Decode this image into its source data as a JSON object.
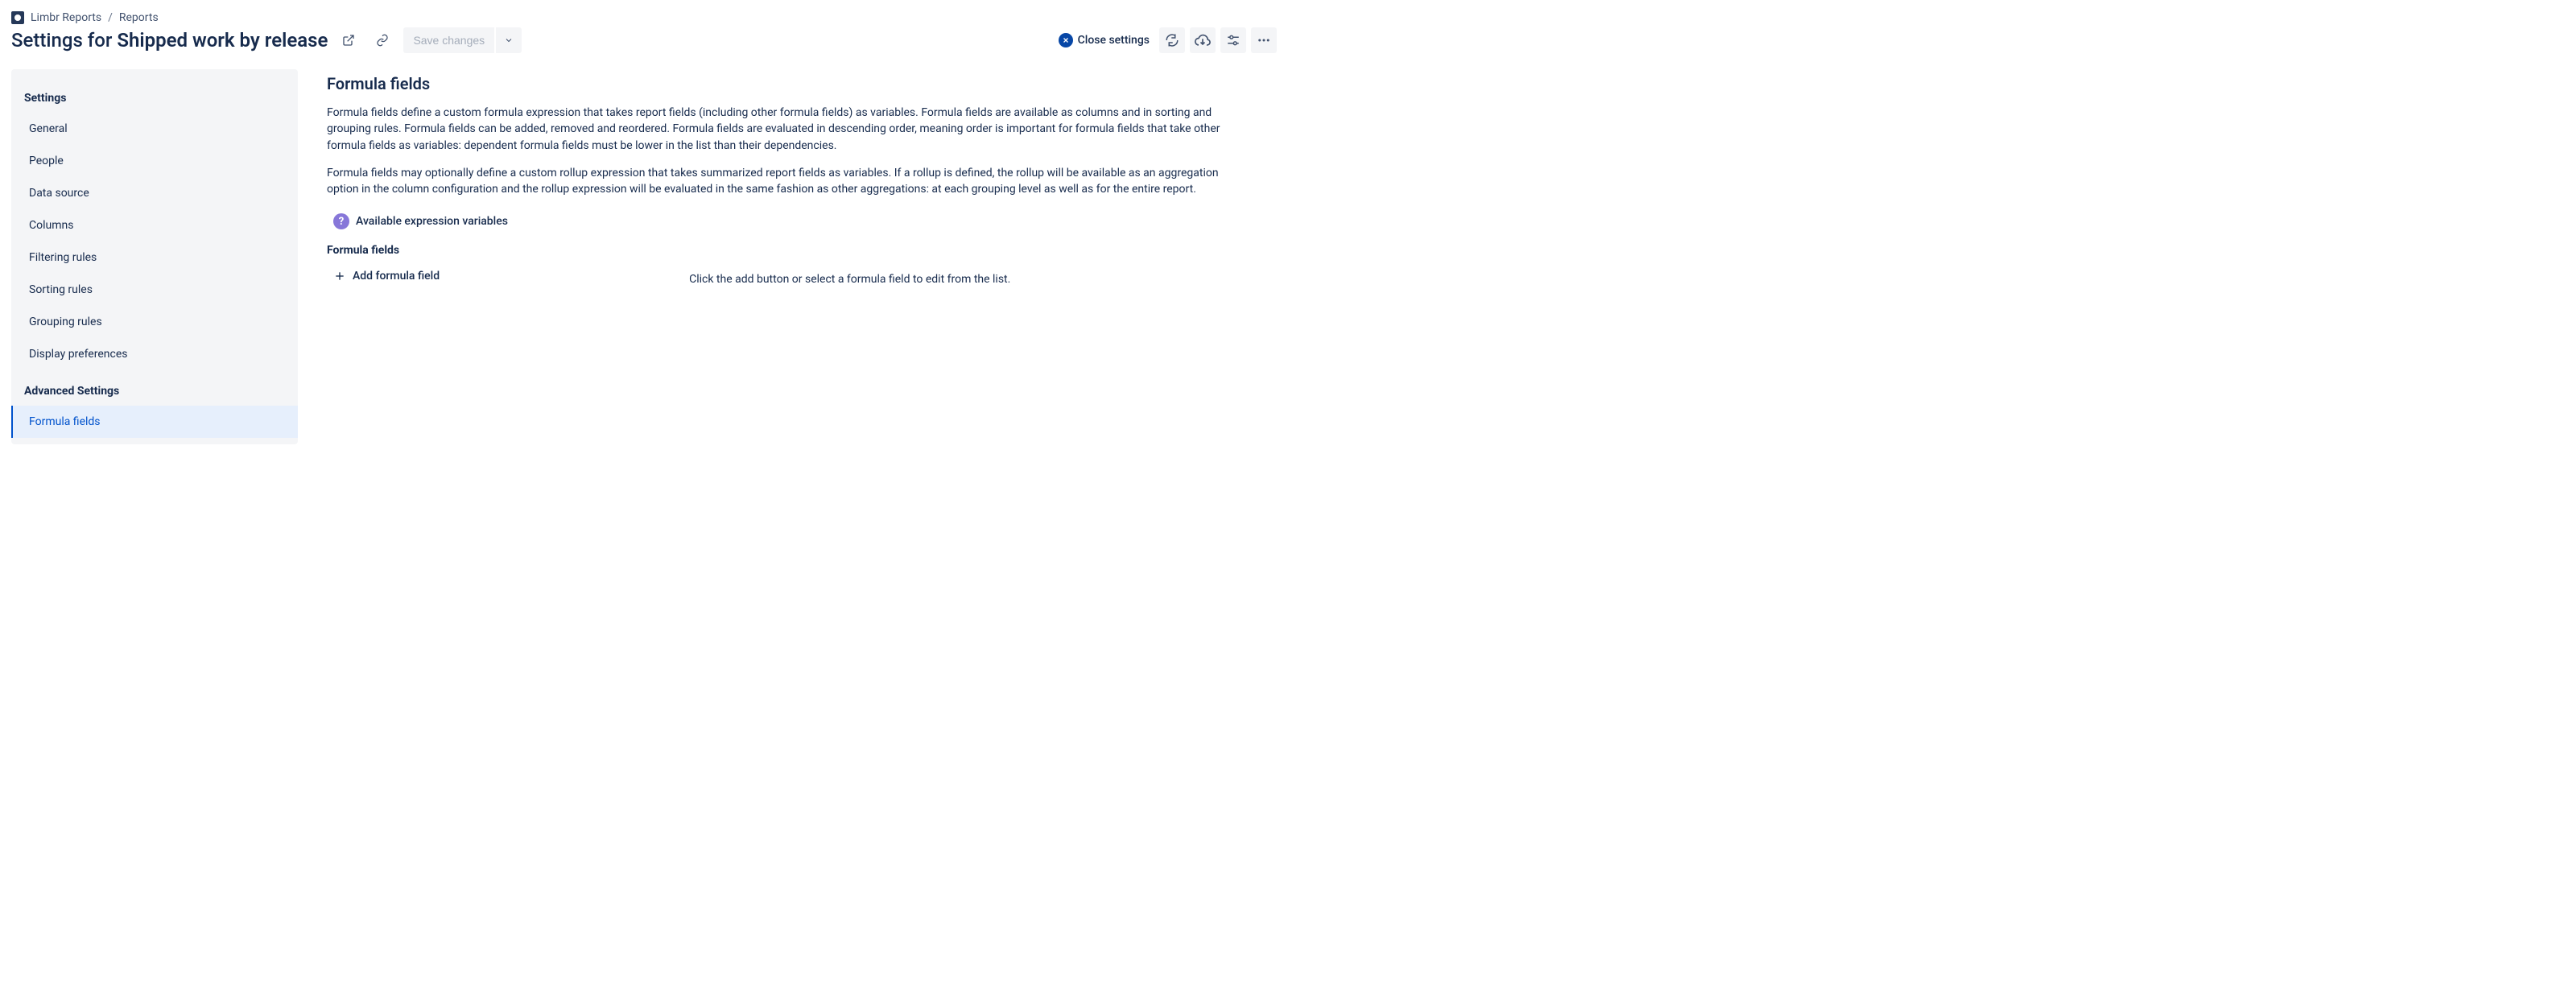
{
  "breadcrumb": {
    "app": "Limbr Reports",
    "section": "Reports"
  },
  "header": {
    "title_prefix": "Settings for ",
    "title_bold": "Shipped work by release",
    "save_label": "Save changes",
    "close_label": "Close settings"
  },
  "sidebar": {
    "heading1": "Settings",
    "items1": [
      {
        "label": "General"
      },
      {
        "label": "People"
      },
      {
        "label": "Data source"
      },
      {
        "label": "Columns"
      },
      {
        "label": "Filtering rules"
      },
      {
        "label": "Sorting rules"
      },
      {
        "label": "Grouping rules"
      },
      {
        "label": "Display preferences"
      }
    ],
    "heading2": "Advanced Settings",
    "items2": [
      {
        "label": "Formula fields",
        "selected": true
      }
    ]
  },
  "content": {
    "title": "Formula fields",
    "para1": "Formula fields define a custom formula expression that takes report fields (including other formula fields) as variables. Formula fields are available as columns and in sorting and grouping rules. Formula fields can be added, removed and reordered. Formula fields are evaluated in descending order, meaning order is important for formula fields that take other formula fields as variables: dependent formula fields must be lower in the list than their dependencies.",
    "para2": "Formula fields may optionally define a custom rollup expression that takes summarized report fields as variables. If a rollup is defined, the rollup will be available as an aggregation option in the column configuration and the rollup expression will be evaluated in the same fashion as other aggregations: at each grouping level as well as for the entire report.",
    "expr_link": "Available expression variables",
    "subsection": "Formula fields",
    "add_label": "Add formula field",
    "hint": "Click the add button or select a formula field to edit from the list."
  }
}
